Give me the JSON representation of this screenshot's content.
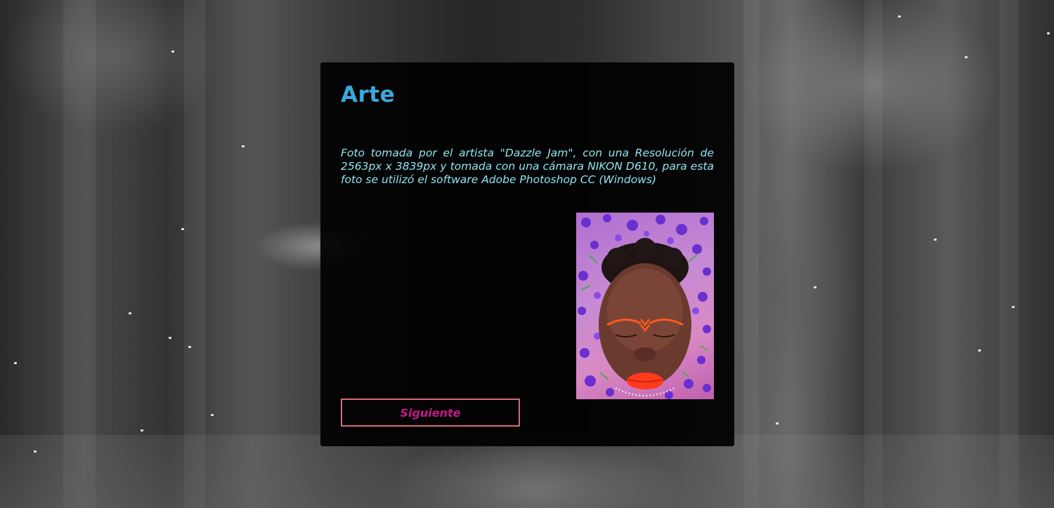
{
  "card": {
    "title": "Arte",
    "description": "Foto tomada por el artista \"Dazzle Jam\", con una Resolución de 2563px x 3839px y tomada con una cámara NIKON D610, para esta foto se utilizó el software Adobe Photoshop CC (Windows)",
    "next_button_label": "Siguiente"
  },
  "colors": {
    "title": "#3aa9dc",
    "description": "#8fe4f2",
    "button_text": "#c4188a",
    "button_border": "#d66a7a",
    "card_background": "#000000"
  }
}
